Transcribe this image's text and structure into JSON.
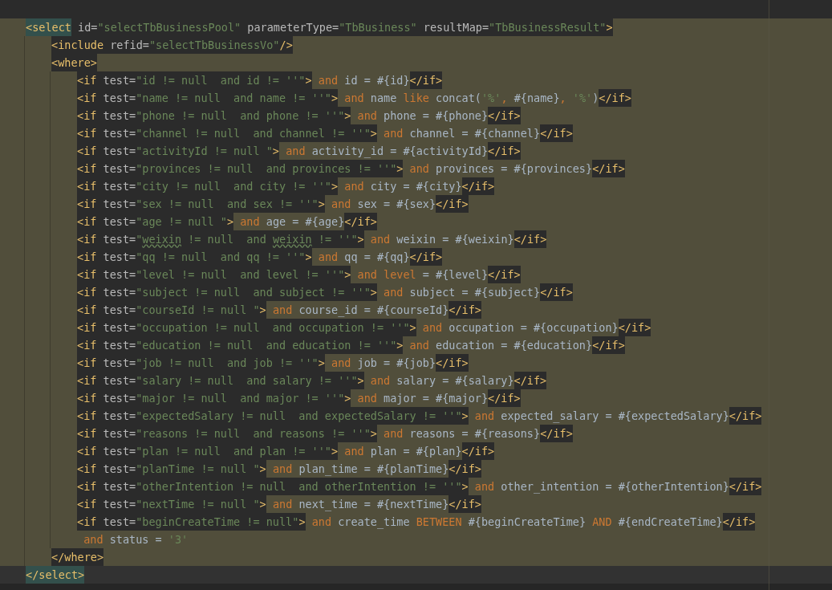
{
  "editor": {
    "lines": [
      {
        "tokens": [
          {
            "kind": "matched",
            "text": "<select"
          },
          {
            "kind": "attr",
            "text": " id="
          },
          {
            "kind": "value",
            "text": "\"selectTbBusinessPool\""
          },
          {
            "kind": "attr",
            "text": " parameterType="
          },
          {
            "kind": "value",
            "text": "\"TbBusiness\""
          },
          {
            "kind": "attr",
            "text": " resultMap="
          },
          {
            "kind": "value",
            "text": "\"TbBusinessResult\""
          },
          {
            "kind": "tag",
            "text": ">"
          }
        ],
        "children": [
          {
            "tokens": [
              {
                "kind": "tag",
                "text": "<include"
              },
              {
                "kind": "attr",
                "text": " refid="
              },
              {
                "kind": "value",
                "text": "\"selectTbBusinessVo\""
              },
              {
                "kind": "tag",
                "text": "/>"
              }
            ]
          },
          {
            "tokens": [
              {
                "kind": "tag",
                "text": "<where>"
              }
            ],
            "children": [
              {
                "tokens": [
                  {
                    "kind": "tag",
                    "text": "<if"
                  },
                  {
                    "kind": "attr",
                    "text": " test="
                  },
                  {
                    "kind": "value",
                    "text": "\"id != null  and id != ''\""
                  },
                  {
                    "kind": "tag",
                    "text": ">"
                  },
                  {
                    "kind": "kw",
                    "text": " and"
                  },
                  {
                    "kind": "code",
                    "text": " id = #{id}"
                  },
                  {
                    "kind": "tag",
                    "text": "</if>"
                  }
                ]
              },
              {
                "tokens": [
                  {
                    "kind": "tag",
                    "text": "<if"
                  },
                  {
                    "kind": "attr",
                    "text": " test="
                  },
                  {
                    "kind": "value",
                    "text": "\"name != null  and name != ''\""
                  },
                  {
                    "kind": "tag",
                    "text": ">"
                  },
                  {
                    "kind": "kw",
                    "text": " and"
                  },
                  {
                    "kind": "code",
                    "text": " name"
                  },
                  {
                    "kind": "kw",
                    "text": " like"
                  },
                  {
                    "kind": "code",
                    "text": " concat("
                  },
                  {
                    "kind": "str",
                    "text": "'%'"
                  },
                  {
                    "kind": "kw",
                    "text": ","
                  },
                  {
                    "kind": "code",
                    "text": " #{name}"
                  },
                  {
                    "kind": "kw",
                    "text": ","
                  },
                  {
                    "kind": "str",
                    "text": " '%'"
                  },
                  {
                    "kind": "code",
                    "text": ")"
                  },
                  {
                    "kind": "tag",
                    "text": "</if>"
                  }
                ]
              },
              {
                "tokens": [
                  {
                    "kind": "tag",
                    "text": "<if"
                  },
                  {
                    "kind": "attr",
                    "text": " test="
                  },
                  {
                    "kind": "value",
                    "text": "\"phone != null  and phone != ''\""
                  },
                  {
                    "kind": "tag",
                    "text": ">"
                  },
                  {
                    "kind": "kw",
                    "text": " and"
                  },
                  {
                    "kind": "code",
                    "text": " phone = #{phone}"
                  },
                  {
                    "kind": "tag",
                    "text": "</if>"
                  }
                ]
              },
              {
                "tokens": [
                  {
                    "kind": "tag",
                    "text": "<if"
                  },
                  {
                    "kind": "attr",
                    "text": " test="
                  },
                  {
                    "kind": "value",
                    "text": "\"channel != null  and channel != ''\""
                  },
                  {
                    "kind": "tag",
                    "text": ">"
                  },
                  {
                    "kind": "kw",
                    "text": " and"
                  },
                  {
                    "kind": "code",
                    "text": " channel = #{channel}"
                  },
                  {
                    "kind": "tag",
                    "text": "</if>"
                  }
                ]
              },
              {
                "tokens": [
                  {
                    "kind": "tag",
                    "text": "<if"
                  },
                  {
                    "kind": "attr",
                    "text": " test="
                  },
                  {
                    "kind": "value",
                    "text": "\"activityId != null \""
                  },
                  {
                    "kind": "tag",
                    "text": ">"
                  },
                  {
                    "kind": "kw",
                    "text": " and"
                  },
                  {
                    "kind": "code",
                    "text": " activity_id = #{activityId}"
                  },
                  {
                    "kind": "tag",
                    "text": "</if>"
                  }
                ]
              },
              {
                "tokens": [
                  {
                    "kind": "tag",
                    "text": "<if"
                  },
                  {
                    "kind": "attr",
                    "text": " test="
                  },
                  {
                    "kind": "value",
                    "text": "\"provinces != null  and provinces != ''\""
                  },
                  {
                    "kind": "tag",
                    "text": ">"
                  },
                  {
                    "kind": "kw",
                    "text": " and"
                  },
                  {
                    "kind": "code",
                    "text": " provinces = #{provinces}"
                  },
                  {
                    "kind": "tag",
                    "text": "</if>"
                  }
                ]
              },
              {
                "tokens": [
                  {
                    "kind": "tag",
                    "text": "<if"
                  },
                  {
                    "kind": "attr",
                    "text": " test="
                  },
                  {
                    "kind": "value",
                    "text": "\"city != null  and city != ''\""
                  },
                  {
                    "kind": "tag",
                    "text": ">"
                  },
                  {
                    "kind": "kw",
                    "text": " and"
                  },
                  {
                    "kind": "code",
                    "text": " city = #{city}"
                  },
                  {
                    "kind": "tag",
                    "text": "</if>"
                  }
                ]
              },
              {
                "tokens": [
                  {
                    "kind": "tag",
                    "text": "<if"
                  },
                  {
                    "kind": "attr",
                    "text": " test="
                  },
                  {
                    "kind": "value",
                    "text": "\"sex != null  and sex != ''\""
                  },
                  {
                    "kind": "tag",
                    "text": ">"
                  },
                  {
                    "kind": "kw",
                    "text": " and"
                  },
                  {
                    "kind": "code",
                    "text": " sex = #{sex}"
                  },
                  {
                    "kind": "tag",
                    "text": "</if>"
                  }
                ]
              },
              {
                "tokens": [
                  {
                    "kind": "tag",
                    "text": "<if"
                  },
                  {
                    "kind": "attr",
                    "text": " test="
                  },
                  {
                    "kind": "value",
                    "text": "\"age != null \""
                  },
                  {
                    "kind": "tag",
                    "text": ">"
                  },
                  {
                    "kind": "kw",
                    "text": " and"
                  },
                  {
                    "kind": "code",
                    "text": " age = #{age}"
                  },
                  {
                    "kind": "tag",
                    "text": "</if>"
                  }
                ]
              },
              {
                "tokens": [
                  {
                    "kind": "tag",
                    "text": "<if"
                  },
                  {
                    "kind": "attr",
                    "text": " test="
                  },
                  {
                    "kind": "value",
                    "text": "\""
                  },
                  {
                    "kind": "typo",
                    "text": "weixin"
                  },
                  {
                    "kind": "value",
                    "text": " != null  and "
                  },
                  {
                    "kind": "typo",
                    "text": "weixin"
                  },
                  {
                    "kind": "value",
                    "text": " != ''\""
                  },
                  {
                    "kind": "tag",
                    "text": ">"
                  },
                  {
                    "kind": "kw",
                    "text": " and"
                  },
                  {
                    "kind": "code",
                    "text": " weixin = #{weixin}"
                  },
                  {
                    "kind": "tag",
                    "text": "</if>"
                  }
                ]
              },
              {
                "tokens": [
                  {
                    "kind": "tag",
                    "text": "<if"
                  },
                  {
                    "kind": "attr",
                    "text": " test="
                  },
                  {
                    "kind": "value",
                    "text": "\"qq != null  and qq != ''\""
                  },
                  {
                    "kind": "tag",
                    "text": ">"
                  },
                  {
                    "kind": "kw",
                    "text": " and"
                  },
                  {
                    "kind": "code",
                    "text": " qq = #{qq}"
                  },
                  {
                    "kind": "tag",
                    "text": "</if>"
                  }
                ]
              },
              {
                "tokens": [
                  {
                    "kind": "tag",
                    "text": "<if"
                  },
                  {
                    "kind": "attr",
                    "text": " test="
                  },
                  {
                    "kind": "value",
                    "text": "\"level != null  and level != ''\""
                  },
                  {
                    "kind": "tag",
                    "text": ">"
                  },
                  {
                    "kind": "kw",
                    "text": " and level"
                  },
                  {
                    "kind": "code",
                    "text": " = #{level}"
                  },
                  {
                    "kind": "tag",
                    "text": "</if>"
                  }
                ]
              },
              {
                "tokens": [
                  {
                    "kind": "tag",
                    "text": "<if"
                  },
                  {
                    "kind": "attr",
                    "text": " test="
                  },
                  {
                    "kind": "value",
                    "text": "\"subject != null  and subject != ''\""
                  },
                  {
                    "kind": "tag",
                    "text": ">"
                  },
                  {
                    "kind": "kw",
                    "text": " and"
                  },
                  {
                    "kind": "code",
                    "text": " subject = #{subject}"
                  },
                  {
                    "kind": "tag",
                    "text": "</if>"
                  }
                ]
              },
              {
                "tokens": [
                  {
                    "kind": "tag",
                    "text": "<if"
                  },
                  {
                    "kind": "attr",
                    "text": " test="
                  },
                  {
                    "kind": "value",
                    "text": "\"courseId != null \""
                  },
                  {
                    "kind": "tag",
                    "text": ">"
                  },
                  {
                    "kind": "kw",
                    "text": " and"
                  },
                  {
                    "kind": "code",
                    "text": " course_id = #{courseId}"
                  },
                  {
                    "kind": "tag",
                    "text": "</if>"
                  }
                ]
              },
              {
                "tokens": [
                  {
                    "kind": "tag",
                    "text": "<if"
                  },
                  {
                    "kind": "attr",
                    "text": " test="
                  },
                  {
                    "kind": "value",
                    "text": "\"occupation != null  and occupation != ''\""
                  },
                  {
                    "kind": "tag",
                    "text": ">"
                  },
                  {
                    "kind": "kw",
                    "text": " and"
                  },
                  {
                    "kind": "code",
                    "text": " occupation = #{occupation}"
                  },
                  {
                    "kind": "tag",
                    "text": "</if>"
                  }
                ]
              },
              {
                "tokens": [
                  {
                    "kind": "tag",
                    "text": "<if"
                  },
                  {
                    "kind": "attr",
                    "text": " test="
                  },
                  {
                    "kind": "value",
                    "text": "\"education != null  and education != ''\""
                  },
                  {
                    "kind": "tag",
                    "text": ">"
                  },
                  {
                    "kind": "kw",
                    "text": " and"
                  },
                  {
                    "kind": "code",
                    "text": " education = #{education}"
                  },
                  {
                    "kind": "tag",
                    "text": "</if>"
                  }
                ]
              },
              {
                "tokens": [
                  {
                    "kind": "tag",
                    "text": "<if"
                  },
                  {
                    "kind": "attr",
                    "text": " test="
                  },
                  {
                    "kind": "value",
                    "text": "\"job != null  and job != ''\""
                  },
                  {
                    "kind": "tag",
                    "text": ">"
                  },
                  {
                    "kind": "kw",
                    "text": " and"
                  },
                  {
                    "kind": "code",
                    "text": " job = #{job}"
                  },
                  {
                    "kind": "tag",
                    "text": "</if>"
                  }
                ]
              },
              {
                "tokens": [
                  {
                    "kind": "tag",
                    "text": "<if"
                  },
                  {
                    "kind": "attr",
                    "text": " test="
                  },
                  {
                    "kind": "value",
                    "text": "\"salary != null  and salary != ''\""
                  },
                  {
                    "kind": "tag",
                    "text": ">"
                  },
                  {
                    "kind": "kw",
                    "text": " and"
                  },
                  {
                    "kind": "code",
                    "text": " salary = #{salary}"
                  },
                  {
                    "kind": "tag",
                    "text": "</if>"
                  }
                ]
              },
              {
                "tokens": [
                  {
                    "kind": "tag",
                    "text": "<if"
                  },
                  {
                    "kind": "attr",
                    "text": " test="
                  },
                  {
                    "kind": "value",
                    "text": "\"major != null  and major != ''\""
                  },
                  {
                    "kind": "tag",
                    "text": ">"
                  },
                  {
                    "kind": "kw",
                    "text": " and"
                  },
                  {
                    "kind": "code",
                    "text": " major = #{major}"
                  },
                  {
                    "kind": "tag",
                    "text": "</if>"
                  }
                ]
              },
              {
                "tokens": [
                  {
                    "kind": "tag",
                    "text": "<if"
                  },
                  {
                    "kind": "attr",
                    "text": " test="
                  },
                  {
                    "kind": "value",
                    "text": "\"expectedSalary != null  and expectedSalary != ''\""
                  },
                  {
                    "kind": "tag",
                    "text": ">"
                  },
                  {
                    "kind": "kw",
                    "text": " and"
                  },
                  {
                    "kind": "code",
                    "text": " expected_salary = #{expectedSalary}"
                  },
                  {
                    "kind": "tag",
                    "text": "</if>"
                  }
                ]
              },
              {
                "tokens": [
                  {
                    "kind": "tag",
                    "text": "<if"
                  },
                  {
                    "kind": "attr",
                    "text": " test="
                  },
                  {
                    "kind": "value",
                    "text": "\"reasons != null  and reasons != ''\""
                  },
                  {
                    "kind": "tag",
                    "text": ">"
                  },
                  {
                    "kind": "kw",
                    "text": " and"
                  },
                  {
                    "kind": "code",
                    "text": " reasons = #{reasons}"
                  },
                  {
                    "kind": "tag",
                    "text": "</if>"
                  }
                ]
              },
              {
                "tokens": [
                  {
                    "kind": "tag",
                    "text": "<if"
                  },
                  {
                    "kind": "attr",
                    "text": " test="
                  },
                  {
                    "kind": "value",
                    "text": "\"plan != null  and plan != ''\""
                  },
                  {
                    "kind": "tag",
                    "text": ">"
                  },
                  {
                    "kind": "kw",
                    "text": " and"
                  },
                  {
                    "kind": "code",
                    "text": " plan = #{plan}"
                  },
                  {
                    "kind": "tag",
                    "text": "</if>"
                  }
                ]
              },
              {
                "tokens": [
                  {
                    "kind": "tag",
                    "text": "<if"
                  },
                  {
                    "kind": "attr",
                    "text": " test="
                  },
                  {
                    "kind": "value",
                    "text": "\"planTime != null \""
                  },
                  {
                    "kind": "tag",
                    "text": ">"
                  },
                  {
                    "kind": "kw",
                    "text": " and"
                  },
                  {
                    "kind": "code",
                    "text": " plan_time = #{planTime}"
                  },
                  {
                    "kind": "tag",
                    "text": "</if>"
                  }
                ]
              },
              {
                "tokens": [
                  {
                    "kind": "tag",
                    "text": "<if"
                  },
                  {
                    "kind": "attr",
                    "text": " test="
                  },
                  {
                    "kind": "value",
                    "text": "\"otherIntention != null  and otherIntention != ''\""
                  },
                  {
                    "kind": "tag",
                    "text": ">"
                  },
                  {
                    "kind": "kw",
                    "text": " and"
                  },
                  {
                    "kind": "code",
                    "text": " other_intention = #{otherIntention}"
                  },
                  {
                    "kind": "tag",
                    "text": "</if>"
                  }
                ]
              },
              {
                "tokens": [
                  {
                    "kind": "tag",
                    "text": "<if"
                  },
                  {
                    "kind": "attr",
                    "text": " test="
                  },
                  {
                    "kind": "value",
                    "text": "\"nextTime != null \""
                  },
                  {
                    "kind": "tag",
                    "text": ">"
                  },
                  {
                    "kind": "kw",
                    "text": " and"
                  },
                  {
                    "kind": "code",
                    "text": " next_time = #{nextTime}"
                  },
                  {
                    "kind": "tag",
                    "text": "</if>"
                  }
                ]
              },
              {
                "tokens": [
                  {
                    "kind": "tag",
                    "text": "<if"
                  },
                  {
                    "kind": "attr",
                    "text": " test="
                  },
                  {
                    "kind": "value",
                    "text": "\"beginCreateTime != null\""
                  },
                  {
                    "kind": "tag",
                    "text": ">"
                  },
                  {
                    "kind": "kw",
                    "text": " and"
                  },
                  {
                    "kind": "code",
                    "text": " create_time"
                  },
                  {
                    "kind": "kw",
                    "text": " BETWEEN"
                  },
                  {
                    "kind": "code",
                    "text": " #{beginCreateTime}"
                  },
                  {
                    "kind": "kw",
                    "text": " AND"
                  },
                  {
                    "kind": "code",
                    "text": " #{endCreateTime}"
                  },
                  {
                    "kind": "tag",
                    "text": "</if>"
                  }
                ]
              },
              {
                "tokens": [
                  {
                    "kind": "kw",
                    "text": " and"
                  },
                  {
                    "kind": "code",
                    "text": " status ="
                  },
                  {
                    "kind": "str",
                    "text": " '3'"
                  }
                ]
              }
            ],
            "closing": {
              "current": false,
              "tokens": [
                {
                  "kind": "tag",
                  "text": "</where>"
                }
              ]
            }
          }
        ],
        "closing": {
          "current": true,
          "tokens": [
            {
              "kind": "matched",
              "text": "</select>"
            }
          ]
        }
      }
    ]
  }
}
